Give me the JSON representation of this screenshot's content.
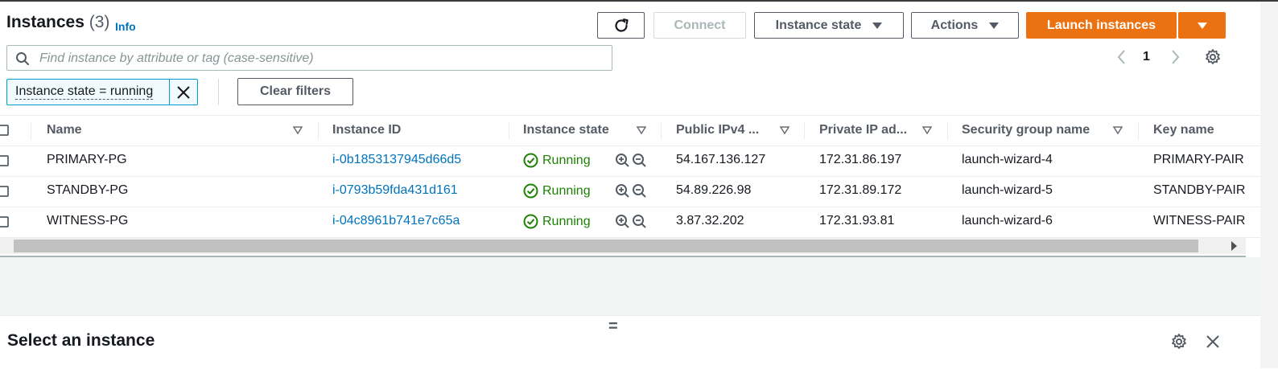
{
  "header": {
    "title": "Instances",
    "count": "(3)",
    "info_label": "Info"
  },
  "toolbar": {
    "connect_label": "Connect",
    "instance_state_label": "Instance state",
    "actions_label": "Actions",
    "launch_label": "Launch instances"
  },
  "search": {
    "placeholder": "Find instance by attribute or tag (case-sensitive)",
    "value": ""
  },
  "pagination": {
    "current_page": "1"
  },
  "filters": {
    "token_label": "Instance state = running",
    "clear_label": "Clear filters"
  },
  "table": {
    "columns": [
      "Name",
      "Instance ID",
      "Instance state",
      "Public IPv4 ...",
      "Private IP ad...",
      "Security group name",
      "Key name"
    ],
    "rows": [
      {
        "name": "PRIMARY-PG",
        "instance_id": "i-0b1853137945d66d5",
        "state": "Running",
        "public_ip": "54.167.136.127",
        "private_ip": "172.31.86.197",
        "security_group": "launch-wizard-4",
        "key_name": "PRIMARY-PAIR"
      },
      {
        "name": "STANDBY-PG",
        "instance_id": "i-0793b59fda431d161",
        "state": "Running",
        "public_ip": "54.89.226.98",
        "private_ip": "172.31.89.172",
        "security_group": "launch-wizard-5",
        "key_name": "STANDBY-PAIR"
      },
      {
        "name": "WITNESS-PG",
        "instance_id": "i-04c8961b741e7c65a",
        "state": "Running",
        "public_ip": "3.87.32.202",
        "private_ip": "172.31.93.81",
        "security_group": "launch-wizard-6",
        "key_name": "WITNESS-PAIR"
      }
    ]
  },
  "split_panel": {
    "handle": "=",
    "title": "Select an instance"
  },
  "colors": {
    "primary": "#ec7211",
    "link": "#0073bb",
    "success": "#1d8102",
    "filter_border": "#00a1c9"
  },
  "icons": [
    "refresh-icon",
    "caret-down-icon",
    "search-icon",
    "chevron-left-icon",
    "chevron-right-icon",
    "settings-gear-icon",
    "close-icon",
    "status-ok-icon",
    "zoom-in-icon",
    "zoom-out-icon",
    "sort-icon"
  ]
}
